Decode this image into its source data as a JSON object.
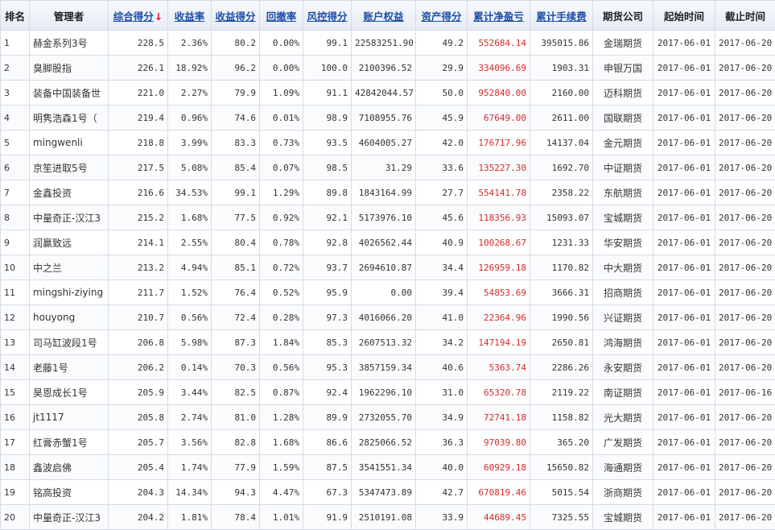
{
  "colors": {
    "pnl_text": "#d62a2a",
    "link_text": "#1d4ea8",
    "sort_arrow": "#e13"
  },
  "header": {
    "rank": "排名",
    "manager": "管理者",
    "composite": "综合得分",
    "sort_icon": "↓",
    "return_rate": "收益率",
    "return_score": "收益得分",
    "drawdown": "回撤率",
    "risk_score": "风控得分",
    "equity": "账户权益",
    "asset_score": "资产得分",
    "net_pnl": "累计净盈亏",
    "fees": "累计手续费",
    "broker": "期货公司",
    "start_date": "起始时间",
    "end_date": "截止时间"
  },
  "rows": [
    {
      "rank": "1",
      "manager": "赫金系列3号",
      "composite": "228.5",
      "return_rate": "2.36%",
      "return_score": "80.2",
      "drawdown": "0.00%",
      "risk_score": "99.1",
      "equity": "22583251.90",
      "asset_score": "49.2",
      "net_pnl": "552684.14",
      "fees": "395015.86",
      "broker": "金瑞期货",
      "start": "2017-06-01",
      "end": "2017-06-20"
    },
    {
      "rank": "2",
      "manager": "臭脚股指",
      "composite": "226.1",
      "return_rate": "18.92%",
      "return_score": "96.2",
      "drawdown": "0.00%",
      "risk_score": "100.0",
      "equity": "2100396.52",
      "asset_score": "29.9",
      "net_pnl": "334096.69",
      "fees": "1903.31",
      "broker": "申银万国",
      "start": "2017-06-01",
      "end": "2017-06-20"
    },
    {
      "rank": "3",
      "manager": "装备中国装备世",
      "composite": "221.0",
      "return_rate": "2.27%",
      "return_score": "79.9",
      "drawdown": "1.09%",
      "risk_score": "91.1",
      "equity": "42842044.57",
      "asset_score": "50.0",
      "net_pnl": "952840.00",
      "fees": "2160.00",
      "broker": "迈科期货",
      "start": "2017-06-01",
      "end": "2017-06-20"
    },
    {
      "rank": "4",
      "manager": "明隽浩森1号（",
      "composite": "219.4",
      "return_rate": "0.96%",
      "return_score": "74.6",
      "drawdown": "0.01%",
      "risk_score": "98.9",
      "equity": "7108955.76",
      "asset_score": "45.9",
      "net_pnl": "67649.00",
      "fees": "2611.00",
      "broker": "国联期货",
      "start": "2017-06-01",
      "end": "2017-06-20"
    },
    {
      "rank": "5",
      "manager": "mingwenli",
      "composite": "218.8",
      "return_rate": "3.99%",
      "return_score": "83.3",
      "drawdown": "0.73%",
      "risk_score": "93.5",
      "equity": "4604005.27",
      "asset_score": "42.0",
      "net_pnl": "176717.96",
      "fees": "14137.04",
      "broker": "金元期货",
      "start": "2017-06-01",
      "end": "2017-06-20"
    },
    {
      "rank": "6",
      "manager": "京笙进取5号",
      "composite": "217.5",
      "return_rate": "5.08%",
      "return_score": "85.4",
      "drawdown": "0.07%",
      "risk_score": "98.5",
      "equity": "31.29",
      "asset_score": "33.6",
      "net_pnl": "135227.30",
      "fees": "1692.70",
      "broker": "中证期货",
      "start": "2017-06-01",
      "end": "2017-06-20"
    },
    {
      "rank": "7",
      "manager": "金鑫投资",
      "composite": "216.6",
      "return_rate": "34.53%",
      "return_score": "99.1",
      "drawdown": "1.29%",
      "risk_score": "89.8",
      "equity": "1843164.99",
      "asset_score": "27.7",
      "net_pnl": "554141.78",
      "fees": "2358.22",
      "broker": "东航期货",
      "start": "2017-06-01",
      "end": "2017-06-20"
    },
    {
      "rank": "8",
      "manager": "中量奇正-汉江3",
      "composite": "215.2",
      "return_rate": "1.68%",
      "return_score": "77.5",
      "drawdown": "0.92%",
      "risk_score": "92.1",
      "equity": "5173976.10",
      "asset_score": "45.6",
      "net_pnl": "118356.93",
      "fees": "15093.07",
      "broker": "宝城期货",
      "start": "2017-06-01",
      "end": "2017-06-20"
    },
    {
      "rank": "9",
      "manager": "润赢致远",
      "composite": "214.1",
      "return_rate": "2.55%",
      "return_score": "80.4",
      "drawdown": "0.78%",
      "risk_score": "92.8",
      "equity": "4026562.44",
      "asset_score": "40.9",
      "net_pnl": "100268.67",
      "fees": "1231.33",
      "broker": "华安期货",
      "start": "2017-06-01",
      "end": "2017-06-20"
    },
    {
      "rank": "10",
      "manager": "中之兰",
      "composite": "213.2",
      "return_rate": "4.94%",
      "return_score": "85.1",
      "drawdown": "0.72%",
      "risk_score": "93.7",
      "equity": "2694610.87",
      "asset_score": "34.4",
      "net_pnl": "126959.18",
      "fees": "1170.82",
      "broker": "中大期货",
      "start": "2017-06-01",
      "end": "2017-06-20"
    },
    {
      "rank": "11",
      "manager": "mingshi-ziying",
      "composite": "211.7",
      "return_rate": "1.52%",
      "return_score": "76.4",
      "drawdown": "0.52%",
      "risk_score": "95.9",
      "equity": "0.00",
      "asset_score": "39.4",
      "net_pnl": "54853.69",
      "fees": "3666.31",
      "broker": "招商期货",
      "start": "2017-06-01",
      "end": "2017-06-20"
    },
    {
      "rank": "12",
      "manager": "houyong",
      "composite": "210.7",
      "return_rate": "0.56%",
      "return_score": "72.4",
      "drawdown": "0.28%",
      "risk_score": "97.3",
      "equity": "4016066.20",
      "asset_score": "41.0",
      "net_pnl": "22364.96",
      "fees": "1990.56",
      "broker": "兴证期货",
      "start": "2017-06-01",
      "end": "2017-06-20"
    },
    {
      "rank": "13",
      "manager": "司马缸波段1号",
      "composite": "206.8",
      "return_rate": "5.98%",
      "return_score": "87.3",
      "drawdown": "1.84%",
      "risk_score": "85.3",
      "equity": "2607513.32",
      "asset_score": "34.2",
      "net_pnl": "147194.19",
      "fees": "2650.81",
      "broker": "鸿海期货",
      "start": "2017-06-01",
      "end": "2017-06-20"
    },
    {
      "rank": "14",
      "manager": "老藤1号",
      "composite": "206.2",
      "return_rate": "0.14%",
      "return_score": "70.3",
      "drawdown": "0.56%",
      "risk_score": "95.3",
      "equity": "3857159.34",
      "asset_score": "40.6",
      "net_pnl": "5363.74",
      "fees": "2286.26",
      "broker": "永安期货",
      "start": "2017-06-01",
      "end": "2017-06-20"
    },
    {
      "rank": "15",
      "manager": "昊恩成长1号",
      "composite": "205.9",
      "return_rate": "3.44%",
      "return_score": "82.5",
      "drawdown": "0.87%",
      "risk_score": "92.4",
      "equity": "1962296.10",
      "asset_score": "31.0",
      "net_pnl": "65320.78",
      "fees": "2119.22",
      "broker": "南证期货",
      "start": "2017-06-01",
      "end": "2017-06-16"
    },
    {
      "rank": "16",
      "manager": "jt1117",
      "composite": "205.8",
      "return_rate": "2.74%",
      "return_score": "81.0",
      "drawdown": "1.28%",
      "risk_score": "89.9",
      "equity": "2732055.70",
      "asset_score": "34.9",
      "net_pnl": "72741.18",
      "fees": "1158.82",
      "broker": "光大期货",
      "start": "2017-06-01",
      "end": "2017-06-20"
    },
    {
      "rank": "17",
      "manager": "红膏赤蟹1号",
      "composite": "205.7",
      "return_rate": "3.56%",
      "return_score": "82.8",
      "drawdown": "1.68%",
      "risk_score": "86.6",
      "equity": "2825066.52",
      "asset_score": "36.3",
      "net_pnl": "97039.80",
      "fees": "365.20",
      "broker": "广发期货",
      "start": "2017-06-01",
      "end": "2017-06-20"
    },
    {
      "rank": "18",
      "manager": "鑫波启佛",
      "composite": "205.4",
      "return_rate": "1.74%",
      "return_score": "77.9",
      "drawdown": "1.59%",
      "risk_score": "87.5",
      "equity": "3541551.34",
      "asset_score": "40.0",
      "net_pnl": "60929.18",
      "fees": "15650.82",
      "broker": "海通期货",
      "start": "2017-06-01",
      "end": "2017-06-20"
    },
    {
      "rank": "19",
      "manager": "铭高投资",
      "composite": "204.3",
      "return_rate": "14.34%",
      "return_score": "94.3",
      "drawdown": "4.47%",
      "risk_score": "67.3",
      "equity": "5347473.89",
      "asset_score": "42.7",
      "net_pnl": "670819.46",
      "fees": "5015.54",
      "broker": "浙商期货",
      "start": "2017-06-01",
      "end": "2017-06-20"
    },
    {
      "rank": "20",
      "manager": "中量奇正-汉江3",
      "composite": "204.2",
      "return_rate": "1.81%",
      "return_score": "78.4",
      "drawdown": "1.01%",
      "risk_score": "91.9",
      "equity": "2510191.08",
      "asset_score": "33.9",
      "net_pnl": "44689.45",
      "fees": "7325.55",
      "broker": "宝城期货",
      "start": "2017-06-01",
      "end": "2017-06-20"
    }
  ]
}
